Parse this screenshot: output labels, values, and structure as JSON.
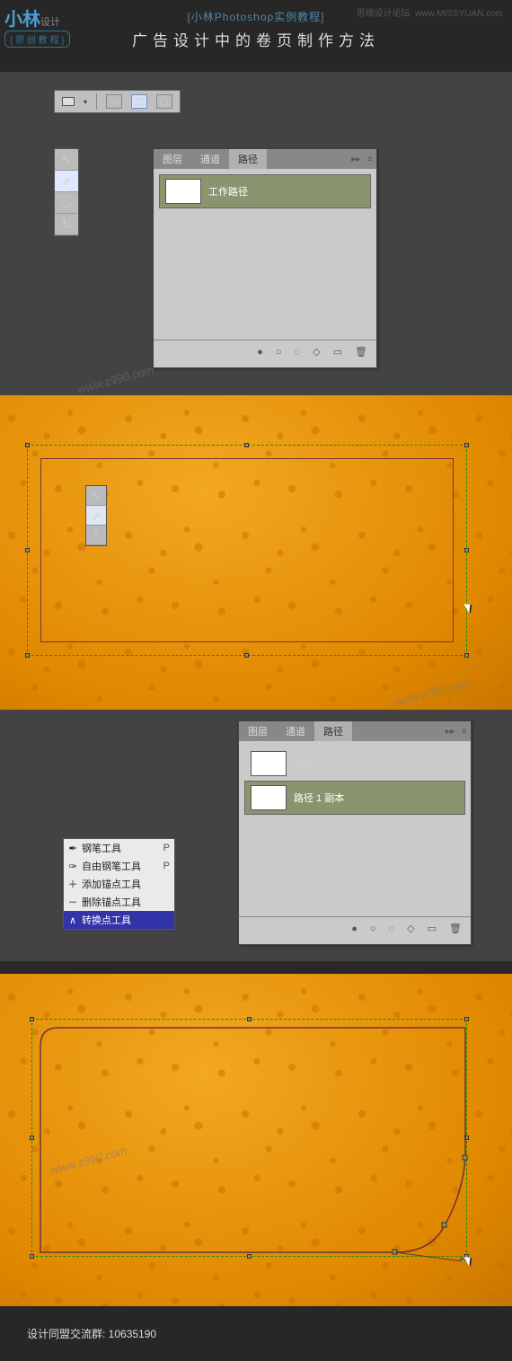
{
  "header": {
    "logo_main": "小林",
    "logo_sub": "设计",
    "logo_tag": "{ 原 创 教 程 }",
    "right_text1": "思缘设计论坛",
    "right_text2": "www.MISSYUAN.com",
    "subtitle": "[小林Photoshop实例教程]",
    "title": "广告设计中的卷页制作方法"
  },
  "panel_tabs": {
    "layers": "图层",
    "channels": "通道",
    "paths": "路径"
  },
  "panel1": {
    "work_path": "工作路径"
  },
  "panel3": {
    "path1": "路径 1",
    "path1copy": "路径 1 副本"
  },
  "pen_menu": {
    "pen": {
      "label": "钢笔工具",
      "shortcut": "P"
    },
    "freeform": {
      "label": "自由钢笔工具",
      "shortcut": "P"
    },
    "addanchor": {
      "label": "添加锚点工具",
      "shortcut": ""
    },
    "delanchor": {
      "label": "删除锚点工具",
      "shortcut": ""
    },
    "convert": {
      "label": "转换点工具",
      "shortcut": ""
    }
  },
  "watermark": "www.z990.com",
  "footer_label": "设计同盟交流群: ",
  "footer_qq": "10635190"
}
